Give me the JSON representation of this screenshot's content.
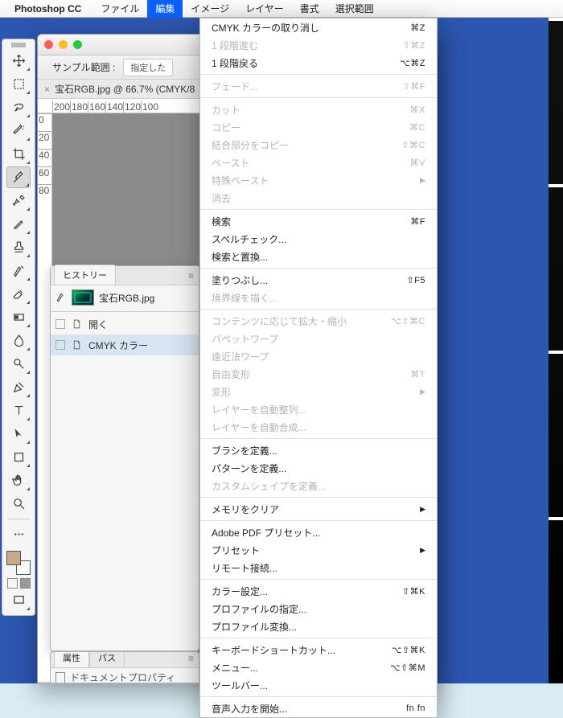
{
  "menubar": {
    "app": "Photoshop CC",
    "items": [
      "ファイル",
      "編集",
      "イメージ",
      "レイヤー",
      "書式",
      "選択範囲"
    ],
    "active_index": 1
  },
  "window": {
    "tab_title": "宝石RGB.jpg @ 66.7% (CMYK/8",
    "sample_label": "サンプル範囲 :",
    "sample_value": "指定した"
  },
  "ruler": {
    "ticks": [
      "200",
      "180",
      "160",
      "140",
      "120",
      "100"
    ],
    "vticks": [
      "0",
      "20",
      "40",
      "60",
      "80"
    ]
  },
  "toolbox": {
    "active": "eyedropper"
  },
  "history": {
    "title": "ヒストリー",
    "image_name": "宝石RGB.jpg",
    "rows": [
      {
        "label": "開く",
        "selected": false
      },
      {
        "label": "CMYK カラー",
        "selected": true
      }
    ]
  },
  "props_panel": {
    "tabs": [
      "属性",
      "パス"
    ],
    "body": "ドキュメントプロパティ"
  },
  "dropdown": {
    "groups": [
      [
        {
          "label": "CMYK カラーの取り消し",
          "sc": "⌘Z"
        },
        {
          "label": "1 段階進む",
          "sc": "⇧⌘Z",
          "dis": true
        },
        {
          "label": "1 段階戻る",
          "sc": "⌥⌘Z"
        }
      ],
      [
        {
          "label": "フェード...",
          "sc": "⇧⌘F",
          "dis": true
        }
      ],
      [
        {
          "label": "カット",
          "sc": "⌘X",
          "dis": true
        },
        {
          "label": "コピー",
          "sc": "⌘C",
          "dis": true
        },
        {
          "label": "結合部分をコピー",
          "sc": "⇧⌘C",
          "dis": true
        },
        {
          "label": "ペースト",
          "sc": "⌘V",
          "dis": true
        },
        {
          "label": "特殊ペースト",
          "arrow": true,
          "dis": true
        },
        {
          "label": "消去",
          "dis": true
        }
      ],
      [
        {
          "label": "検索",
          "sc": "⌘F"
        },
        {
          "label": "スペルチェック..."
        },
        {
          "label": "検索と置換..."
        }
      ],
      [
        {
          "label": "塗りつぶし...",
          "sc": "⇧F5"
        },
        {
          "label": "境界線を描く...",
          "dis": true
        }
      ],
      [
        {
          "label": "コンテンツに応じて拡大・縮小",
          "sc": "⌥⇧⌘C",
          "dis": true
        },
        {
          "label": "パペットワープ",
          "dis": true
        },
        {
          "label": "遠近法ワープ",
          "dis": true
        },
        {
          "label": "自由変形",
          "sc": "⌘T",
          "dis": true
        },
        {
          "label": "変形",
          "arrow": true,
          "dis": true
        },
        {
          "label": "レイヤーを自動整列...",
          "dis": true
        },
        {
          "label": "レイヤーを自動合成...",
          "dis": true
        }
      ],
      [
        {
          "label": "ブラシを定義..."
        },
        {
          "label": "パターンを定義..."
        },
        {
          "label": "カスタムシェイプを定義...",
          "dis": true
        }
      ],
      [
        {
          "label": "メモリをクリア",
          "arrow": true
        }
      ],
      [
        {
          "label": "Adobe PDF プリセット..."
        },
        {
          "label": "プリセット",
          "arrow": true
        },
        {
          "label": "リモート接続..."
        }
      ],
      [
        {
          "label": "カラー設定...",
          "sc": "⇧⌘K"
        },
        {
          "label": "プロファイルの指定..."
        },
        {
          "label": "プロファイル変換..."
        }
      ],
      [
        {
          "label": "キーボードショートカット...",
          "sc": "⌥⇧⌘K"
        },
        {
          "label": "メニュー...",
          "sc": "⌥⇧⌘M"
        },
        {
          "label": "ツールバー..."
        }
      ],
      [
        {
          "label": "音声入力を開始...",
          "sc": "fn fn"
        }
      ]
    ]
  }
}
